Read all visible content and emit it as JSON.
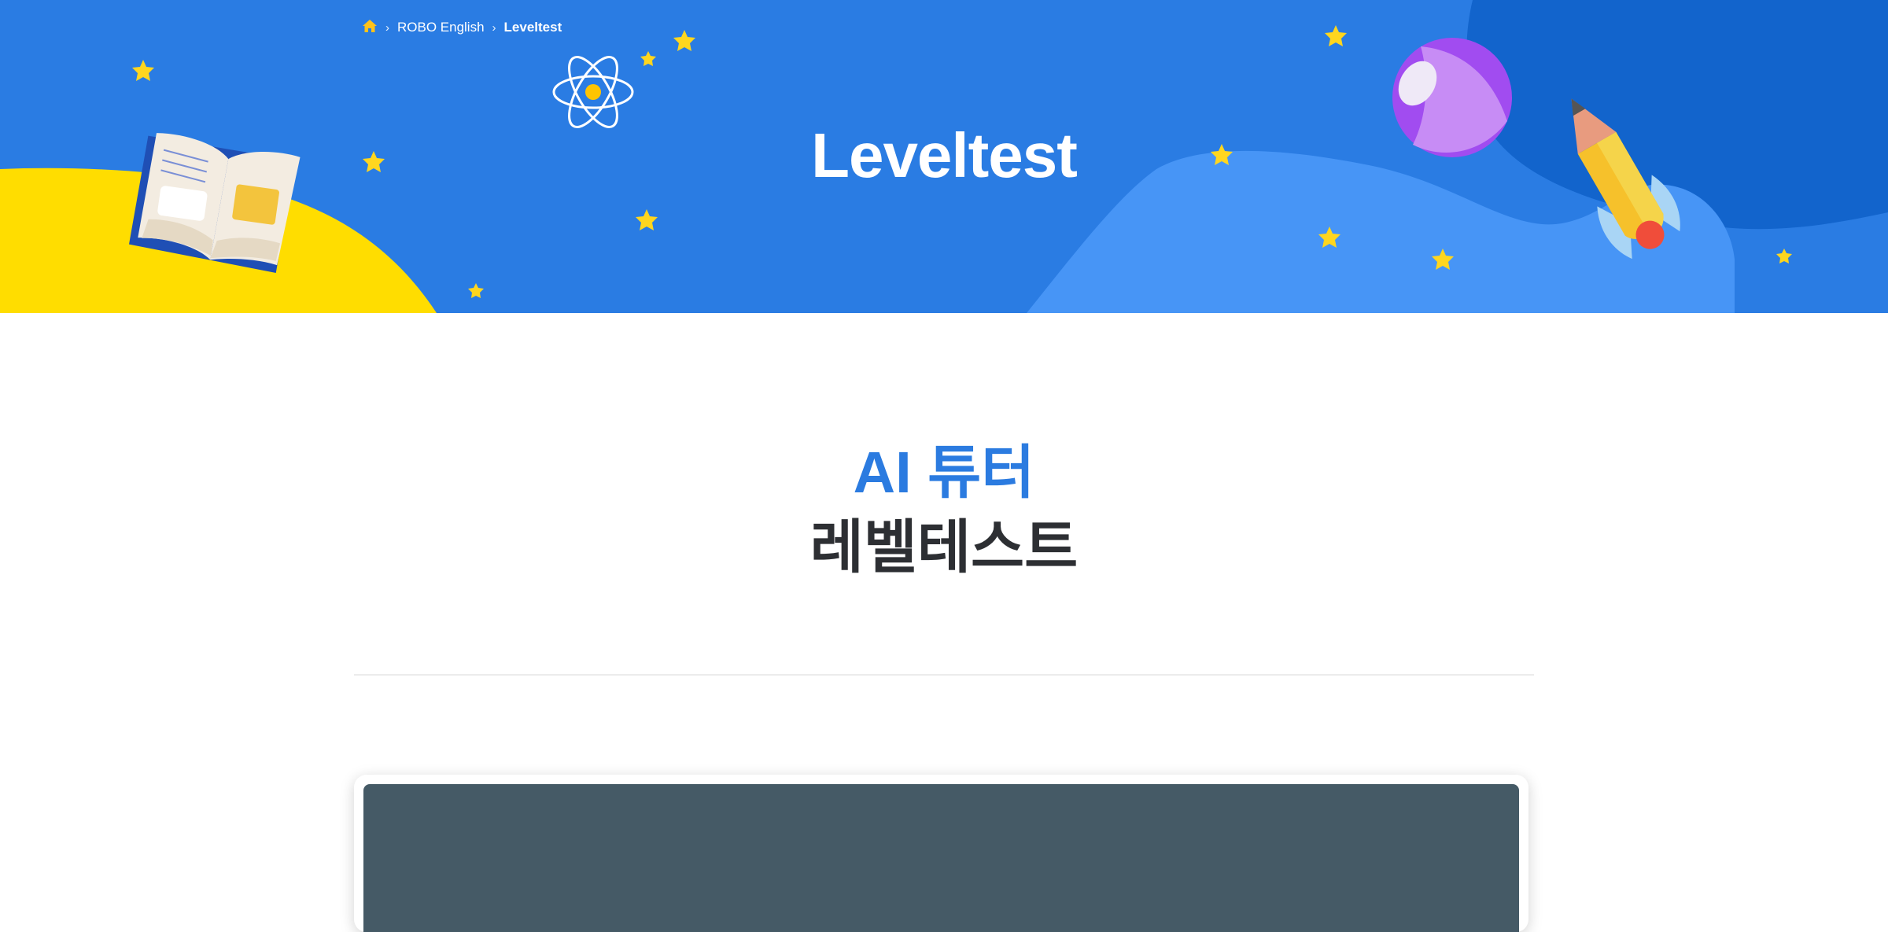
{
  "breadcrumb": {
    "home_icon": "home-icon",
    "items": [
      "ROBO English",
      "Leveltest"
    ]
  },
  "hero": {
    "title": "Leveltest"
  },
  "intro": {
    "line1": "AI 튜터",
    "line2": "레벨테스트"
  },
  "colors": {
    "hero_bg": "#2a7ce3",
    "accent_blue": "#2b7be0",
    "heading_dark": "#2d2f33",
    "yellow": "#ffdd00",
    "light_blue_wave": "#4795f6",
    "dark_blue_wave": "#1264cc",
    "star": "#ffd61f",
    "screen_bg": "#455a66"
  }
}
